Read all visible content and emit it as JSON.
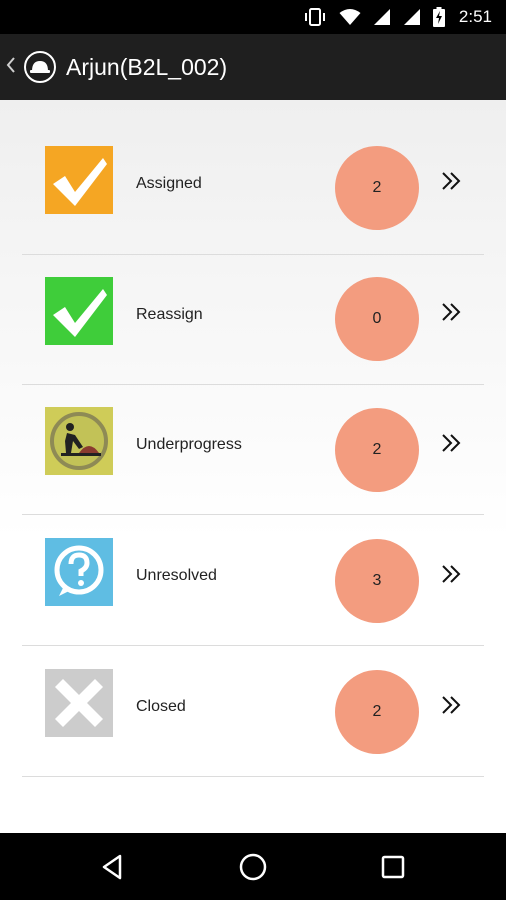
{
  "status_bar": {
    "time": "2:51",
    "icons": [
      "vibrate-icon",
      "wifi-icon",
      "signal-icon",
      "signal-icon",
      "battery-charging-icon"
    ]
  },
  "app_bar": {
    "back_icon": "chevron-left-icon",
    "logo_icon": "helmet-logo-icon",
    "title": "Arjun(B2L_002)"
  },
  "rows": [
    {
      "label": "Assigned",
      "count": "2",
      "icon": "checkmark-icon",
      "icon_color": "#f5a623"
    },
    {
      "label": "Reassign",
      "count": "0",
      "icon": "checkmark-icon",
      "icon_color": "#3fcd3a"
    },
    {
      "label": "Underprogress",
      "count": "2",
      "icon": "worker-icon",
      "icon_color": "#cfcc58"
    },
    {
      "label": "Unresolved",
      "count": "3",
      "icon": "question-icon",
      "icon_color": "#5fbde3"
    },
    {
      "label": "Closed",
      "count": "2",
      "icon": "close-x-icon",
      "icon_color": "#cccccc"
    }
  ],
  "count_color": "#f39c7f",
  "nav_bar": {
    "icons": [
      "back-triangle-icon",
      "home-circle-icon",
      "recents-square-icon"
    ]
  }
}
